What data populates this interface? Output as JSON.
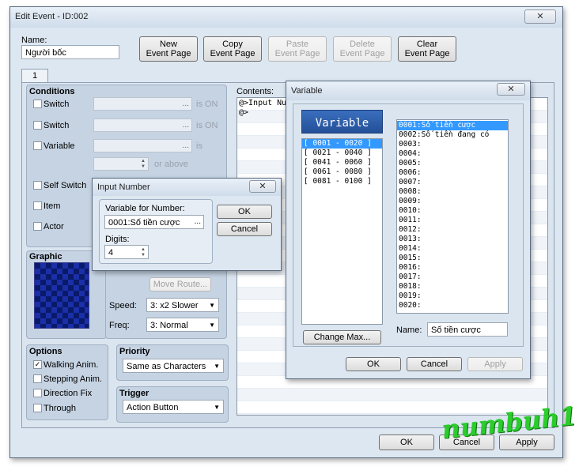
{
  "main": {
    "title": "Edit Event - ID:002",
    "name_label": "Name:",
    "name_value": "Người bốc",
    "buttons": {
      "new": [
        "New",
        "Event Page"
      ],
      "copy": [
        "Copy",
        "Event Page"
      ],
      "paste": [
        "Paste",
        "Event Page"
      ],
      "delete": [
        "Delete",
        "Event Page"
      ],
      "clear": [
        "Clear",
        "Event Page"
      ]
    },
    "tab": "1",
    "conditions": {
      "title": "Conditions",
      "switch1": "Switch",
      "switch2": "Switch",
      "variable": "Variable",
      "is_on1": "is ON",
      "is_on2": "is ON",
      "is": "is",
      "or_above": "or above",
      "self_switch": "Self Switch",
      "item": "Item",
      "actor": "Actor"
    },
    "graphic_label": "Graphic",
    "move_route_label": "Move Route...",
    "speed_label": "Speed:",
    "speed_value": "3: x2 Slower",
    "freq_label": "Freq:",
    "freq_value": "3: Normal",
    "options": {
      "title": "Options",
      "walking": "Walking Anim.",
      "stepping": "Stepping Anim.",
      "direction_fix": "Direction Fix",
      "through": "Through"
    },
    "priority": {
      "title": "Priority",
      "value": "Same as Characters"
    },
    "trigger": {
      "title": "Trigger",
      "value": "Action Button"
    },
    "contents_label": "Contents:",
    "contents_lines": [
      "@>Input Nur",
      "@>"
    ],
    "ok": "OK",
    "cancel": "Cancel",
    "apply": "Apply",
    "close_glyph": "✕"
  },
  "input_number": {
    "title": "Input Number",
    "variable_label": "Variable for Number:",
    "variable_value": "0001:Số tiền cược",
    "digits_label": "Digits:",
    "digits_value": "4",
    "ok": "OK",
    "cancel": "Cancel",
    "ellipsis": "..."
  },
  "variable_dialog": {
    "title": "Variable",
    "header": "Variable",
    "groups": [
      "[ 0001 - 0020 ]",
      "[ 0021 - 0040 ]",
      "[ 0041 - 0060 ]",
      "[ 0061 - 0080 ]",
      "[ 0081 - 0100 ]"
    ],
    "items": [
      "0001:Số tiền cược",
      "0002:Số tiền đang có",
      "0003:",
      "0004:",
      "0005:",
      "0006:",
      "0007:",
      "0008:",
      "0009:",
      "0010:",
      "0011:",
      "0012:",
      "0013:",
      "0014:",
      "0015:",
      "0016:",
      "0017:",
      "0018:",
      "0019:",
      "0020:"
    ],
    "change_max": "Change Max...",
    "name_label": "Name:",
    "name_value": "Số tiền cược",
    "ok": "OK",
    "cancel": "Cancel",
    "apply": "Apply"
  },
  "watermark": "numbuh1",
  "colors": {
    "accent": "#3399ff",
    "header_blue": "#2b5ea8",
    "watermark": "#22cc22"
  }
}
